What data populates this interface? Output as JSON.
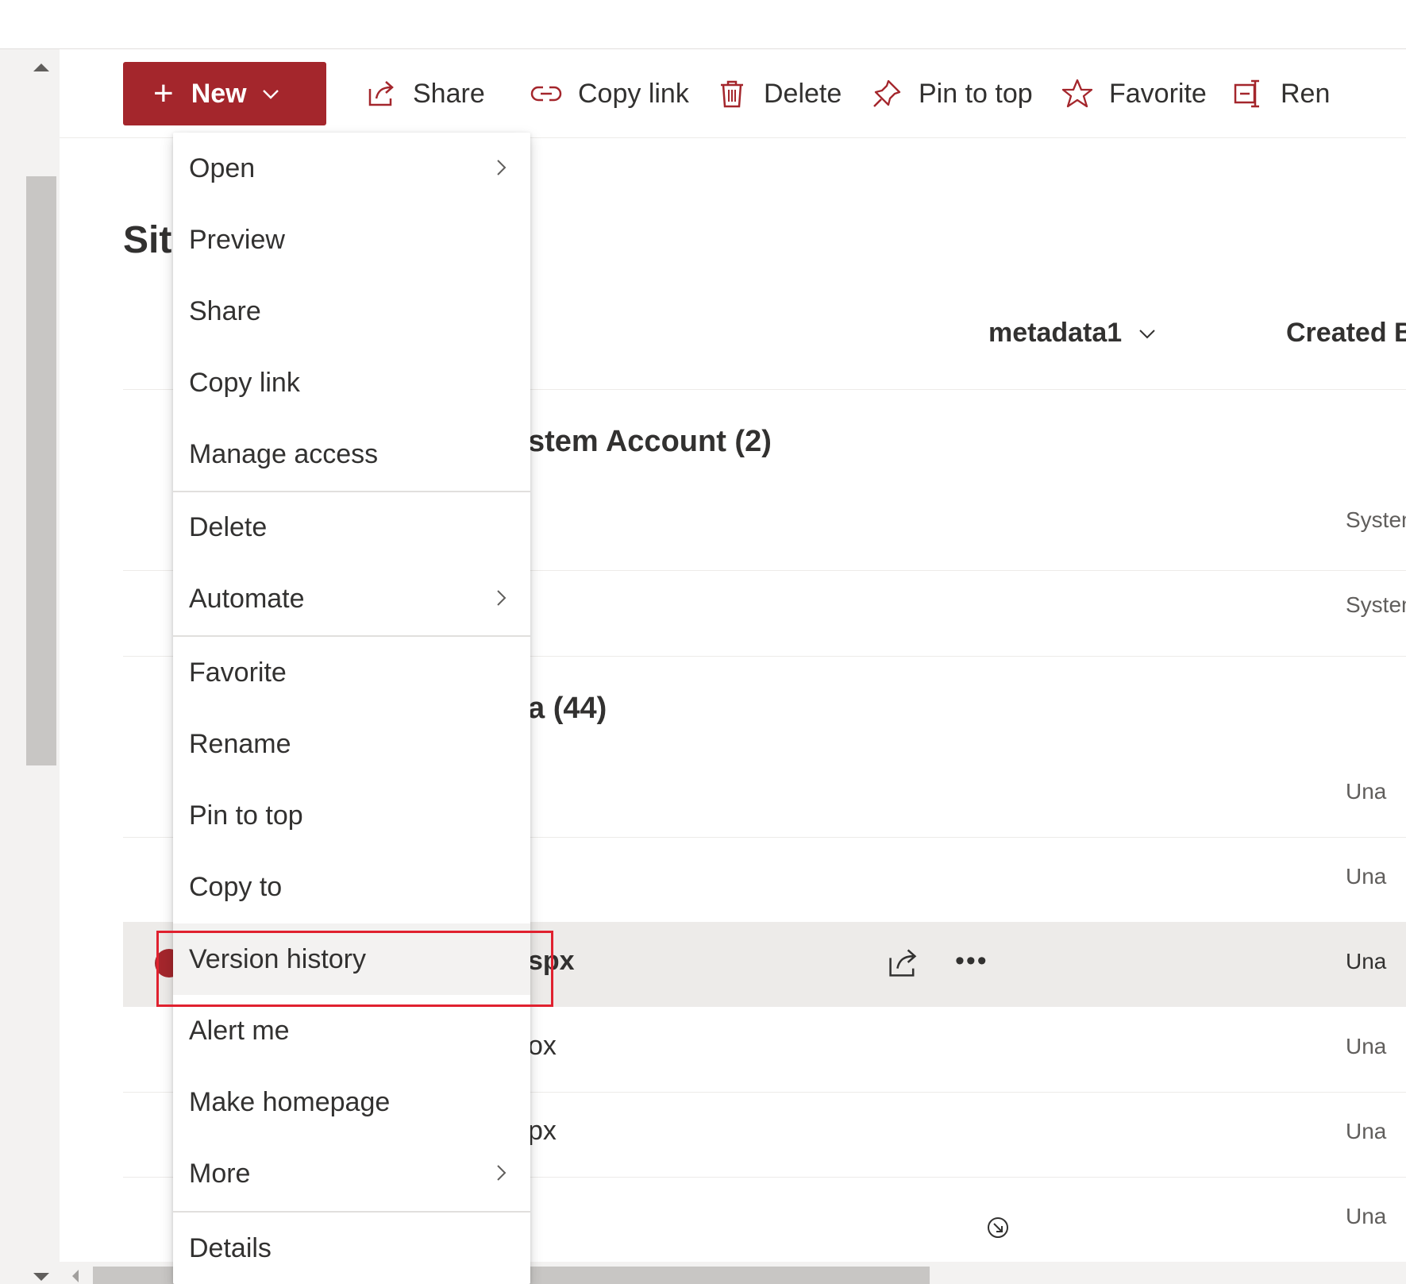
{
  "command_bar": {
    "new_label": "New",
    "share_label": "Share",
    "copy_link_label": "Copy link",
    "delete_label": "Delete",
    "pin_label": "Pin to top",
    "favorite_label": "Favorite",
    "rename_label": "Ren"
  },
  "page": {
    "title": "Sit"
  },
  "columns": {
    "metadata1": "metadata1",
    "created_by": "Created B"
  },
  "groups": [
    {
      "label": "stem Account (2)"
    },
    {
      "label": "a (44)"
    }
  ],
  "rows": [
    {
      "name": "",
      "created_by": "System Acco"
    },
    {
      "name": "",
      "created_by": "System Acco"
    },
    {
      "name": "",
      "created_by": "Una"
    },
    {
      "name": "",
      "created_by": "Una"
    },
    {
      "name": "spx",
      "created_by": "Una"
    },
    {
      "name": "ox",
      "created_by": "Una"
    },
    {
      "name": "px",
      "created_by": "Una"
    },
    {
      "name": "",
      "created_by": "Una"
    }
  ],
  "context_menu": {
    "items": [
      {
        "label": "Open",
        "submenu": true
      },
      {
        "label": "Preview",
        "submenu": false
      },
      {
        "label": "Share",
        "submenu": false
      },
      {
        "label": "Copy link",
        "submenu": false
      },
      {
        "label": "Manage access",
        "submenu": false
      },
      {
        "label": "Delete",
        "submenu": false
      },
      {
        "label": "Automate",
        "submenu": true
      },
      {
        "label": "Favorite",
        "submenu": false
      },
      {
        "label": "Rename",
        "submenu": false
      },
      {
        "label": "Pin to top",
        "submenu": false
      },
      {
        "label": "Copy to",
        "submenu": false
      },
      {
        "label": "Version history",
        "submenu": false
      },
      {
        "label": "Alert me",
        "submenu": false
      },
      {
        "label": "Make homepage",
        "submenu": false
      },
      {
        "label": "More",
        "submenu": true
      },
      {
        "label": "Details",
        "submenu": false
      }
    ],
    "highlighted": "Version history"
  },
  "colors": {
    "brand": "#a4262c",
    "focus_outline": "#e0212f",
    "selected_row": "#edebe9"
  },
  "icons": {
    "new": "plus-icon",
    "share": "share-icon",
    "copy_link": "link-icon",
    "delete": "trash-icon",
    "pin": "pin-icon",
    "favorite": "star-icon",
    "rename": "rename-icon"
  }
}
